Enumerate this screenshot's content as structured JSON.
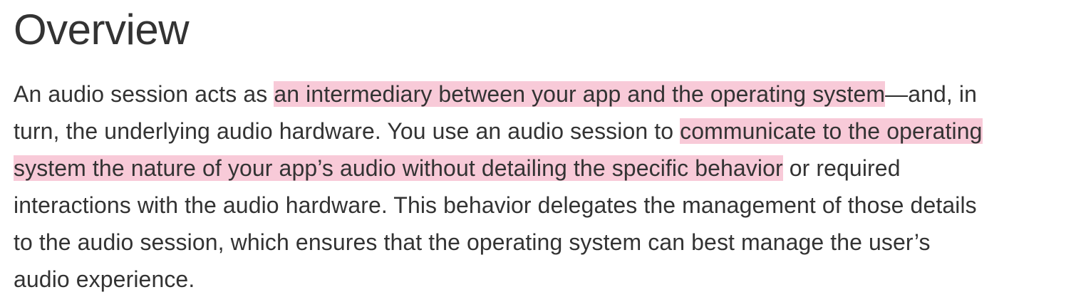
{
  "heading": "Overview",
  "paragraph": {
    "lines": [
      [
        {
          "text": "An audio session acts as ",
          "highlight": false
        },
        {
          "text": "an intermediary between your app and the operating system",
          "highlight": true
        },
        {
          "text": "—and, in",
          "highlight": false
        }
      ],
      [
        {
          "text": "turn, the underlying audio hardware. You use an audio session to ",
          "highlight": false
        },
        {
          "text": "communicate to the operating",
          "highlight": true
        }
      ],
      [
        {
          "text": "system the nature of your app’s audio without detailing the specific behavior",
          "highlight": true
        },
        {
          "text": " or required",
          "highlight": false
        }
      ],
      [
        {
          "text": "interactions with the audio hardware. This behavior delegates the management of those details",
          "highlight": false
        }
      ],
      [
        {
          "text": "to the audio session, which ensures that the operating system can best manage the user’s",
          "highlight": false
        }
      ],
      [
        {
          "text": "audio experience.",
          "highlight": false
        }
      ]
    ]
  },
  "colors": {
    "text": "#333333",
    "highlight": "#f8cad8",
    "background": "#ffffff"
  }
}
